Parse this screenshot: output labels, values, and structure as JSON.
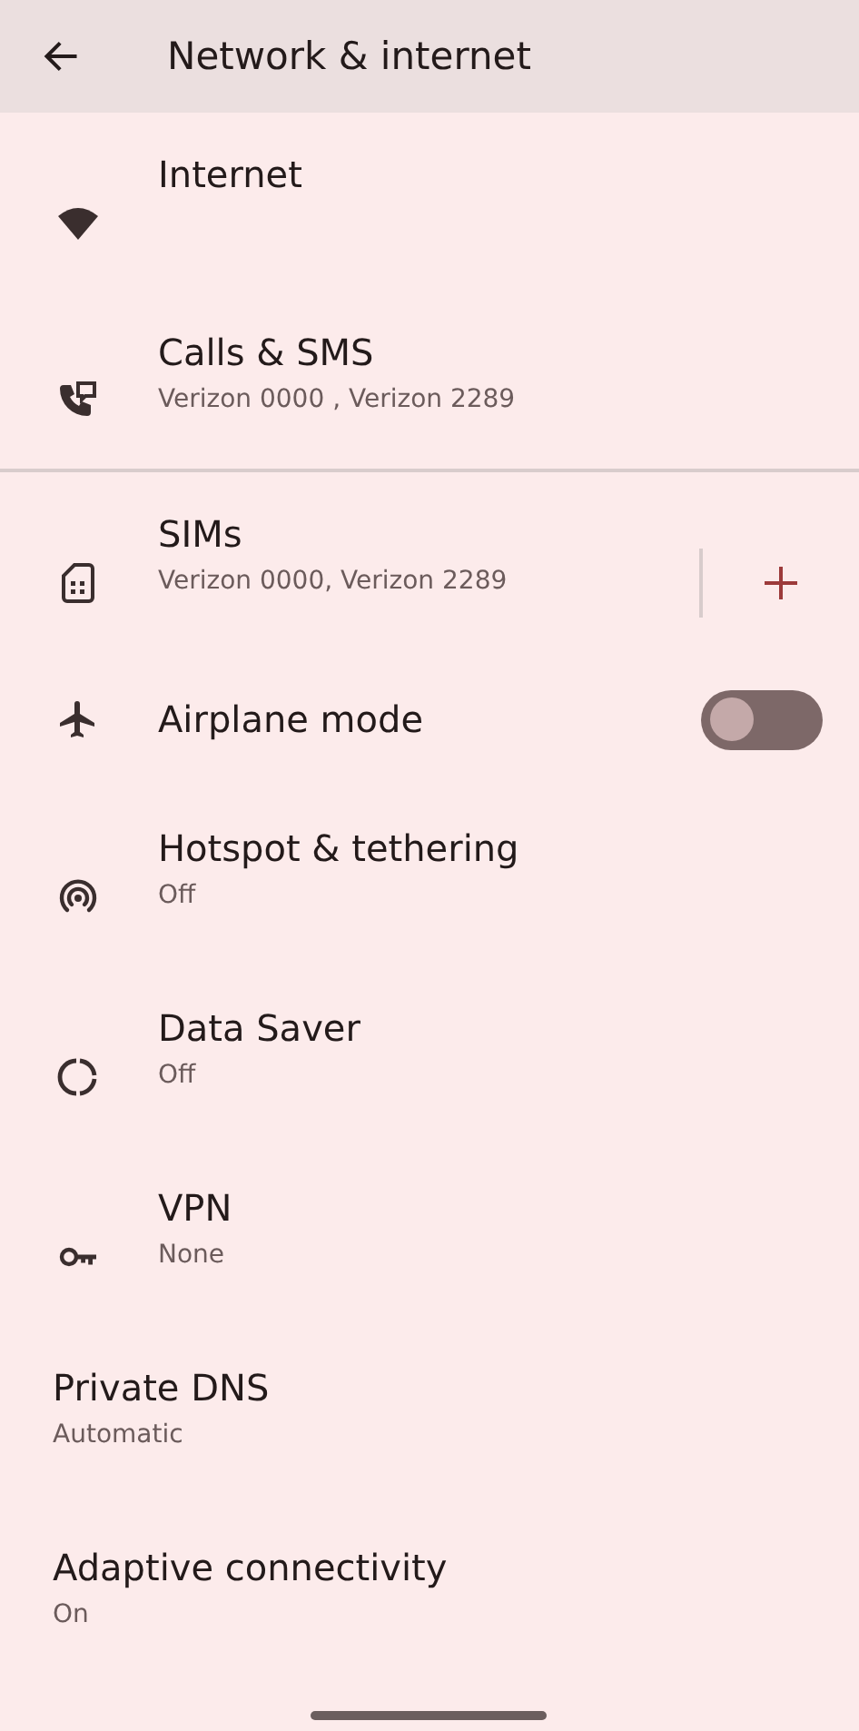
{
  "header": {
    "title": "Network & internet"
  },
  "items": [
    {
      "kind": "icon",
      "title": "Internet"
    },
    {
      "kind": "icon",
      "title": "Calls & SMS",
      "subtitle": "Verizon 0000 , Verizon 2289"
    },
    {
      "kind": "add",
      "title": "SIMs",
      "subtitle": "Verizon 0000, Verizon 2289"
    },
    {
      "kind": "toggle",
      "title": "Airplane mode",
      "on": false
    },
    {
      "kind": "icon",
      "title": "Hotspot & tethering",
      "subtitle": "Off"
    },
    {
      "kind": "icon",
      "title": "Data Saver",
      "subtitle": "Off"
    },
    {
      "kind": "icon",
      "title": "VPN",
      "subtitle": "None"
    },
    {
      "kind": "plain",
      "title": "Private DNS",
      "subtitle": "Automatic"
    },
    {
      "kind": "plain",
      "title": "Adaptive connectivity",
      "subtitle": "On"
    }
  ]
}
